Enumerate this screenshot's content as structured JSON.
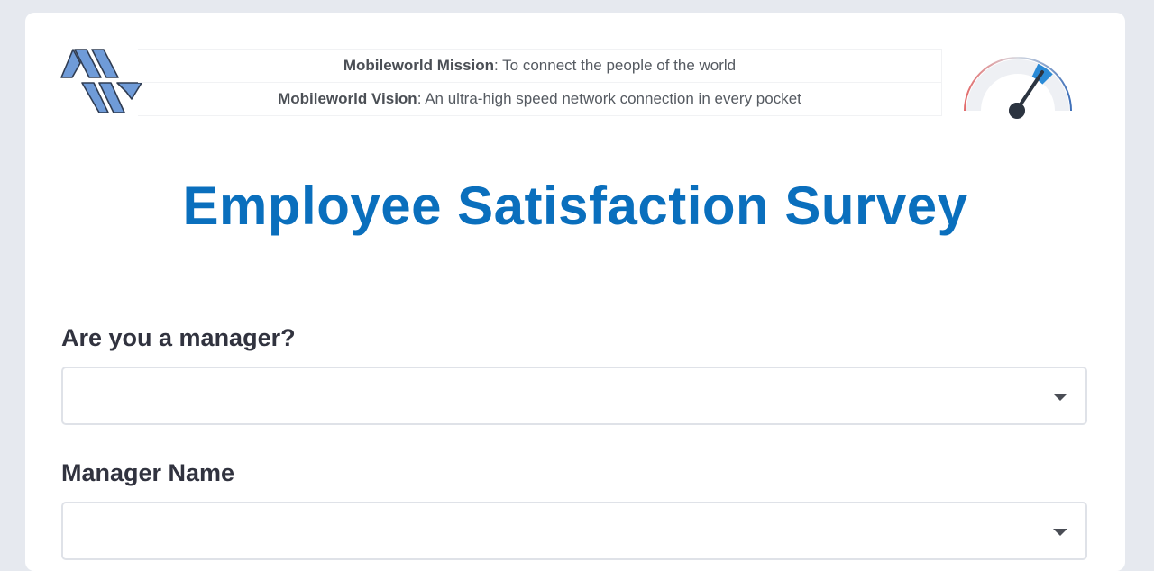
{
  "banner": {
    "mission_label": "Mobileworld Mission",
    "mission_text": ": To connect the people of the world",
    "vision_label": "Mobileworld Vision",
    "vision_text": ": An ultra-high speed network connection in every pocket"
  },
  "logo": {
    "icon": "mobileworld-logo-icon",
    "color": "#6f9bd8"
  },
  "gauge": {
    "icon": "speedometer-icon",
    "level_fraction": 0.78
  },
  "page": {
    "title": "Employee Satisfaction Survey"
  },
  "form": {
    "fields": [
      {
        "label": "Are you a manager?",
        "value": ""
      },
      {
        "label": "Manager Name",
        "value": ""
      }
    ]
  },
  "colors": {
    "title": "#0a6fbd",
    "background": "#e6e9ef",
    "card": "#ffffff",
    "label": "#31333f"
  }
}
